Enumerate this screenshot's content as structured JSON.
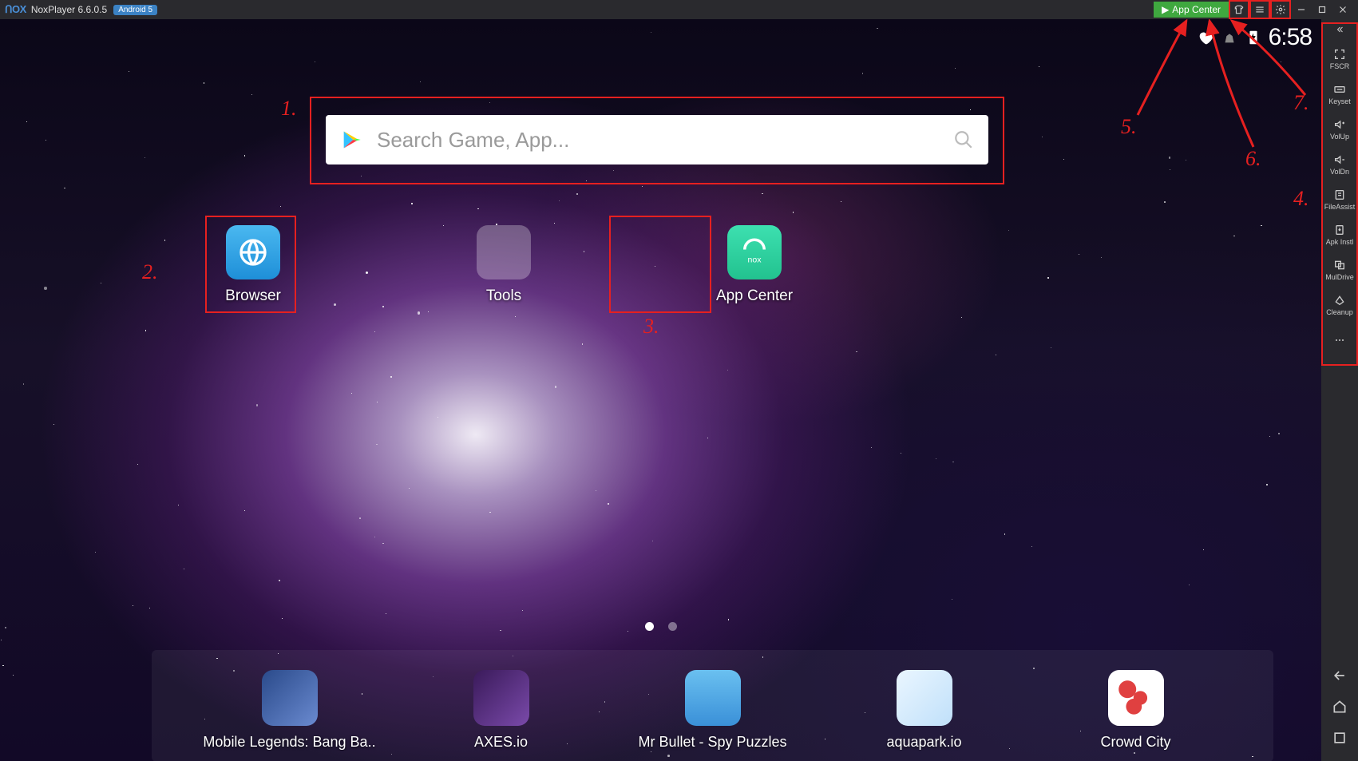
{
  "titlebar": {
    "app_name": "NoxPlayer 6.6.0.5",
    "android_tag": "Android 5",
    "app_center_label": "App Center"
  },
  "status": {
    "time": "6:58"
  },
  "search": {
    "placeholder": "Search Game, App..."
  },
  "home_apps": [
    {
      "id": "browser",
      "label": "Browser"
    },
    {
      "id": "tools",
      "label": "Tools"
    },
    {
      "id": "appcenter",
      "label": "App Center"
    }
  ],
  "sidebar_tools": [
    {
      "id": "fscr",
      "label": "FSCR"
    },
    {
      "id": "keyset",
      "label": "Keyset"
    },
    {
      "id": "volup",
      "label": "VolUp"
    },
    {
      "id": "voldn",
      "label": "VolDn"
    },
    {
      "id": "fileassist",
      "label": "FileAssist"
    },
    {
      "id": "apkinstl",
      "label": "Apk Instl"
    },
    {
      "id": "muldrive",
      "label": "MulDrive"
    },
    {
      "id": "cleanup",
      "label": "Cleanup"
    }
  ],
  "dock_apps": [
    {
      "label": "Mobile Legends: Bang Ba..",
      "bg": "linear-gradient(135deg,#2a4a8a,#5a7ac0)"
    },
    {
      "label": "AXES.io",
      "bg": "linear-gradient(135deg,#3a1a5a,#6a3a9a)"
    },
    {
      "label": "Mr Bullet - Spy Puzzles",
      "bg": "linear-gradient(180deg,#5ab0e8,#2a80c8)"
    },
    {
      "label": "aquapark.io",
      "bg": "linear-gradient(135deg,#e8f4ff,#b8d8f8)"
    },
    {
      "label": "Crowd City",
      "bg": "linear-gradient(135deg,#fff,#f0f0f0)"
    }
  ],
  "annotations": {
    "a1": "1.",
    "a2": "2.",
    "a3": "3.",
    "a4": "4.",
    "a5": "5.",
    "a6": "6.",
    "a7": "7."
  }
}
